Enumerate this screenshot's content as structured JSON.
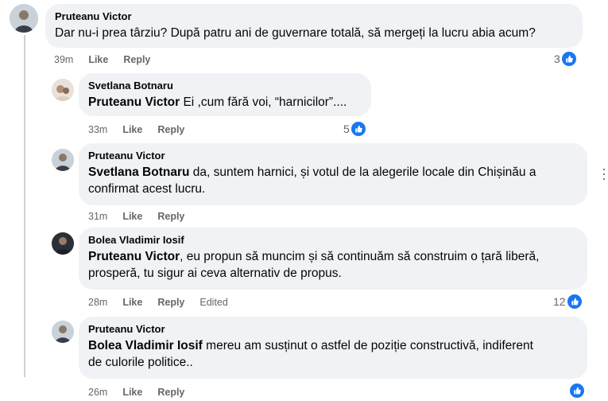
{
  "actions": {
    "like": "Like",
    "reply": "Reply",
    "edited": "Edited"
  },
  "comments": [
    {
      "author": "Pruteanu Victor",
      "mention": "",
      "text": "Dar nu-i prea târziu? După patru ani de guvernare totală, să mergeți la lucru abia acum?",
      "time": "39m",
      "reactions": "3"
    },
    {
      "author": "Svetlana Botnaru",
      "mention": "Pruteanu Victor",
      "text": " Ei ,cum fără voi, “harnicilor”....",
      "time": "33m",
      "reactions": "5"
    },
    {
      "author": "Pruteanu Victor",
      "mention": "Svetlana Botnaru",
      "line1": " da, suntem harnici, și votul de la alegerile locale din Chișinău a",
      "line2": "confirmat acest lucru.",
      "time": "31m",
      "reactions": ""
    },
    {
      "author": "Bolea Vladimir Iosif",
      "mention": "Pruteanu Victor",
      "line1": ", eu propun să muncim și să continuăm să construim o țară liberă,",
      "line2": "prosperă, tu sigur ai ceva alternativ de propus.",
      "time": "28m",
      "reactions": "12",
      "edited": true
    },
    {
      "author": "Pruteanu Victor",
      "mention": "Bolea Vladimir Iosif",
      "line1": " mereu am susținut o astfel de poziție constructivă, indiferent",
      "line2": "de culorile politice..",
      "time": "26m",
      "reactions": ""
    }
  ],
  "colors": {
    "bubble": "#f0f2f5",
    "meta": "#65676b",
    "like": "#1877f2",
    "thread": "#ced0d4"
  },
  "icons": {
    "reaction": "like-thumb-icon",
    "more": "more-options-icon"
  }
}
